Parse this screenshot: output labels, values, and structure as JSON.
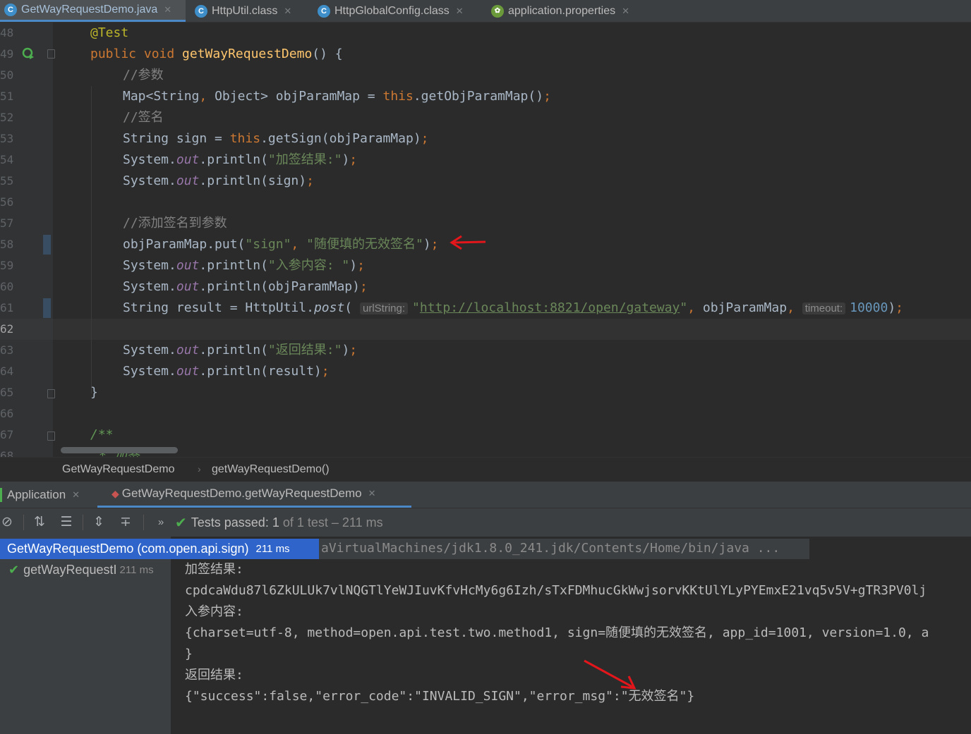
{
  "editor_tabs": [
    {
      "label": "GetWayRequestDemo.java",
      "icon": "C",
      "active": true
    },
    {
      "label": "HttpUtil.class",
      "icon": "C",
      "active": false
    },
    {
      "label": "HttpGlobalConfig.class",
      "icon": "C",
      "active": false
    },
    {
      "label": "application.properties",
      "icon": "leaf",
      "active": false
    }
  ],
  "line_numbers": [
    "48",
    "49",
    "50",
    "51",
    "52",
    "53",
    "54",
    "55",
    "56",
    "57",
    "58",
    "59",
    "60",
    "61",
    "62",
    "63",
    "64",
    "65",
    "66",
    "67",
    "68"
  ],
  "current_line": "62",
  "code": {
    "l48": "@Test",
    "l49": [
      "public void ",
      "getWayRequestDemo",
      "() {"
    ],
    "l50": "//参数",
    "l51": [
      "Map<String",
      ", ",
      "Object> objParamMap = ",
      "this",
      ".getObjParamMap()",
      ";"
    ],
    "l52": "//签名",
    "l53": [
      "String sign = ",
      "this",
      ".getSign(objParamMap)",
      ";"
    ],
    "l54": [
      "System.",
      "out",
      ".println(",
      "\"加签结果:\"",
      ")",
      ";"
    ],
    "l55": [
      "System.",
      "out",
      ".println(sign)",
      ";"
    ],
    "l57": "//添加签名到参数",
    "l58": [
      "objParamMap.put(",
      "\"sign\"",
      ", ",
      "\"随便填的无效签名\"",
      ")",
      ";"
    ],
    "l59": [
      "System.",
      "out",
      ".println(",
      "\"入参内容: \"",
      ")",
      ";"
    ],
    "l60": [
      "System.",
      "out",
      ".println(objParamMap)",
      ";"
    ],
    "l61": [
      "String result = HttpUtil.",
      "post",
      "( ",
      "urlString:",
      "\"",
      "http://localhost:8821/open/gateway",
      "\"",
      ", ",
      "objParamMap",
      ", ",
      "timeout:",
      "10000",
      ")",
      ";"
    ],
    "l63": [
      "System.",
      "out",
      ".println(",
      "\"返回结果:\"",
      ")",
      ";"
    ],
    "l64": [
      "System.",
      "out",
      ".println(result)",
      ";"
    ],
    "l65": "}",
    "l67": "/**",
    "l68": "* 加签"
  },
  "breadcrumb": [
    "GetWayRequestDemo",
    "getWayRequestDemo()"
  ],
  "run_tabs": [
    {
      "label": "Application",
      "active": false
    },
    {
      "label": "GetWayRequestDemo.getWayRequestDemo",
      "active": true
    }
  ],
  "test_status": {
    "passed_label": "Tests passed:",
    "count": "1",
    "of_label": "of 1 test – 211 ms"
  },
  "tree": {
    "root": "GetWayRequestDemo (com.open.api.sign)",
    "root_time": "211 ms",
    "child": "getWayRequestI",
    "child_time": "211 ms"
  },
  "console": {
    "cmd": "aVirtualMachines/jdk1.8.0_241.jdk/Contents/Home/bin/java ...",
    "lines": [
      "加签结果:",
      "cpdcaWdu87l6ZkULUk7vlNQGTlYeWJIuvKfvHcMy6g6Izh/sTxFDMhucGkWwjsorvKKtUlYLyPYEmxE21vq5v5V+gTR3PV0lj",
      "入参内容:",
      "{charset=utf-8, method=open.api.test.two.method1, sign=随便填的无效签名, app_id=1001, version=1.0, a",
      "}",
      "返回结果:",
      "{\"success\":false,\"error_code\":\"INVALID_SIGN\",\"error_msg\":\"无效签名\"}"
    ]
  },
  "colors": {
    "keyword": "#cc7832",
    "string": "#6a8759",
    "comment": "#808080",
    "annotation": "#bbb529",
    "method": "#ffc66d",
    "field": "#9876aa",
    "number": "#6897bb",
    "selection": "#2f65ca",
    "pass_green": "#4dae4f",
    "arrow_red": "#e3161b"
  }
}
